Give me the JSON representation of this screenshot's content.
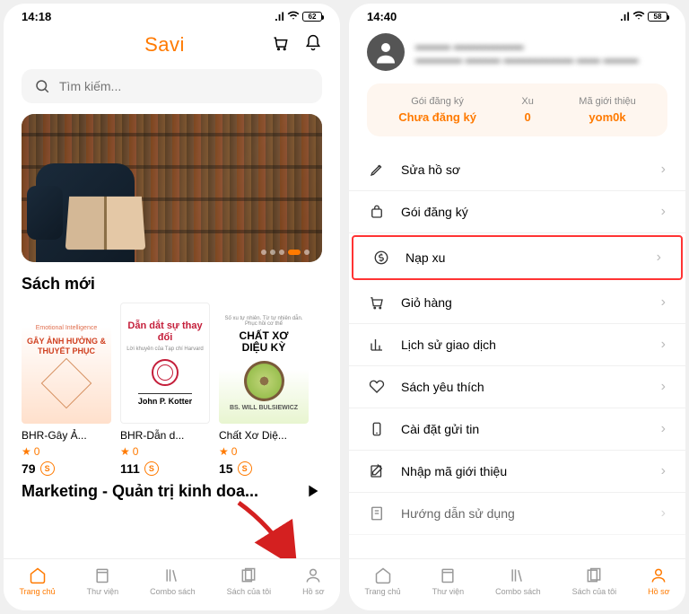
{
  "screen1": {
    "time": "14:18",
    "battery": "62",
    "brand": "Savi",
    "search_placeholder": "Tìm kiếm...",
    "sections": {
      "new_books": "Sách mới",
      "marketing": "Marketing - Quản trị kinh doa..."
    },
    "books": [
      {
        "cover_tag": "Emotional Intelligence",
        "cover_title": "GÂY ẢNH HƯỞNG & THUYẾT PHỤC",
        "title": "BHR-Gây Ả...",
        "rating": "0",
        "price": "79"
      },
      {
        "cover_title": "Dẫn dắt sự thay đổi",
        "cover_sub": "",
        "cover_author": "John P. Kotter",
        "title": "BHR-Dẫn d...",
        "rating": "0",
        "price": "111"
      },
      {
        "cover_top": "Số xu tự nhiên. Từ tự nhiên dẫn. Phục hồi cơ thể",
        "cover_title1": "CHẤT XƠ",
        "cover_title2": "DIỆU KỲ",
        "cover_author": "BS. WILL BULSIEWICZ",
        "title": "Chất Xơ Diệ...",
        "rating": "0",
        "price": "15"
      }
    ]
  },
  "screen2": {
    "time": "14:40",
    "battery": "58",
    "info": {
      "sub_label": "Gói đăng ký",
      "sub_value": "Chưa đăng ký",
      "xu_label": "Xu",
      "xu_value": "0",
      "ref_label": "Mã giới thiệu",
      "ref_value": "yom0k"
    },
    "menu": [
      {
        "label": "Sửa hồ sơ",
        "icon": "edit"
      },
      {
        "label": "Gói đăng ký",
        "icon": "bag"
      },
      {
        "label": "Nạp xu",
        "icon": "dollar",
        "highlight": true
      },
      {
        "label": "Giỏ hàng",
        "icon": "cart"
      },
      {
        "label": "Lịch sử giao dịch",
        "icon": "chart"
      },
      {
        "label": "Sách yêu thích",
        "icon": "heart"
      },
      {
        "label": "Cài đặt gửi tin",
        "icon": "phone"
      },
      {
        "label": "Nhập mã giới thiệu",
        "icon": "compose"
      },
      {
        "label": "Hướng dẫn sử dụng",
        "icon": "doc"
      }
    ]
  },
  "nav": [
    {
      "label": "Trang chủ"
    },
    {
      "label": "Thư viện"
    },
    {
      "label": "Combo sách"
    },
    {
      "label": "Sách của tôi"
    },
    {
      "label": "Hồ sơ"
    }
  ]
}
